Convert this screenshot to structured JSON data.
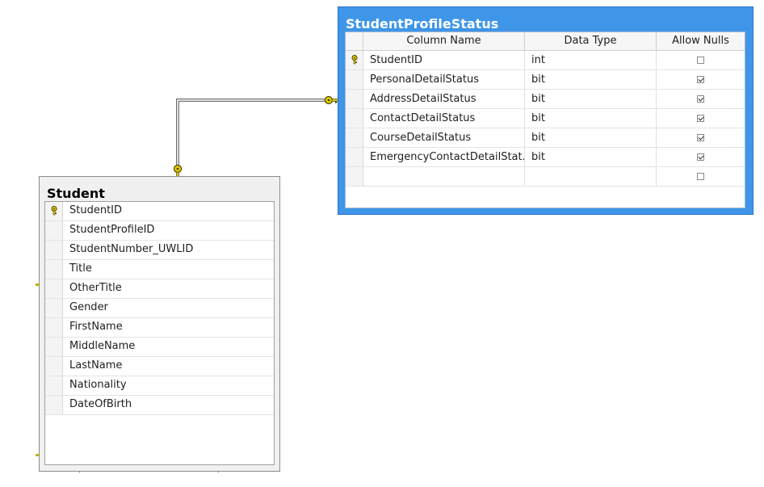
{
  "student": {
    "title": "Student",
    "columns": [
      {
        "name": "StudentID",
        "primary_key": true
      },
      {
        "name": "StudentProfileID"
      },
      {
        "name": "StudentNumber_UWLID"
      },
      {
        "name": "Title"
      },
      {
        "name": "OtherTitle"
      },
      {
        "name": "Gender"
      },
      {
        "name": "FirstName"
      },
      {
        "name": "MiddleName"
      },
      {
        "name": "LastName"
      },
      {
        "name": "Nationality"
      },
      {
        "name": "DateOfBirth"
      }
    ]
  },
  "student_profile_status": {
    "title": "StudentProfileStatus",
    "headers": {
      "column_name": "Column Name",
      "data_type": "Data Type",
      "allow_nulls": "Allow Nulls"
    },
    "rows": [
      {
        "name": "StudentID",
        "type": "int",
        "allow_nulls": false,
        "primary_key": true
      },
      {
        "name": "PersonalDetailStatus",
        "type": "bit",
        "allow_nulls": true
      },
      {
        "name": "AddressDetailStatus",
        "type": "bit",
        "allow_nulls": true
      },
      {
        "name": "ContactDetailStatus",
        "type": "bit",
        "allow_nulls": true
      },
      {
        "name": "CourseDetailStatus",
        "type": "bit",
        "allow_nulls": true
      },
      {
        "name": "EmergencyContactDetailStat...",
        "type": "bit",
        "allow_nulls": true
      },
      {
        "name": "",
        "type": "",
        "allow_nulls": false
      }
    ]
  },
  "colors": {
    "selected_table_header": "#3f96e8",
    "key_icon": "#e6d200",
    "relationship_line": "#707070"
  },
  "relationship": {
    "from": "Student.StudentID",
    "to": "StudentProfileStatus.StudentID",
    "icons": [
      "key-icon",
      "key-icon"
    ]
  }
}
